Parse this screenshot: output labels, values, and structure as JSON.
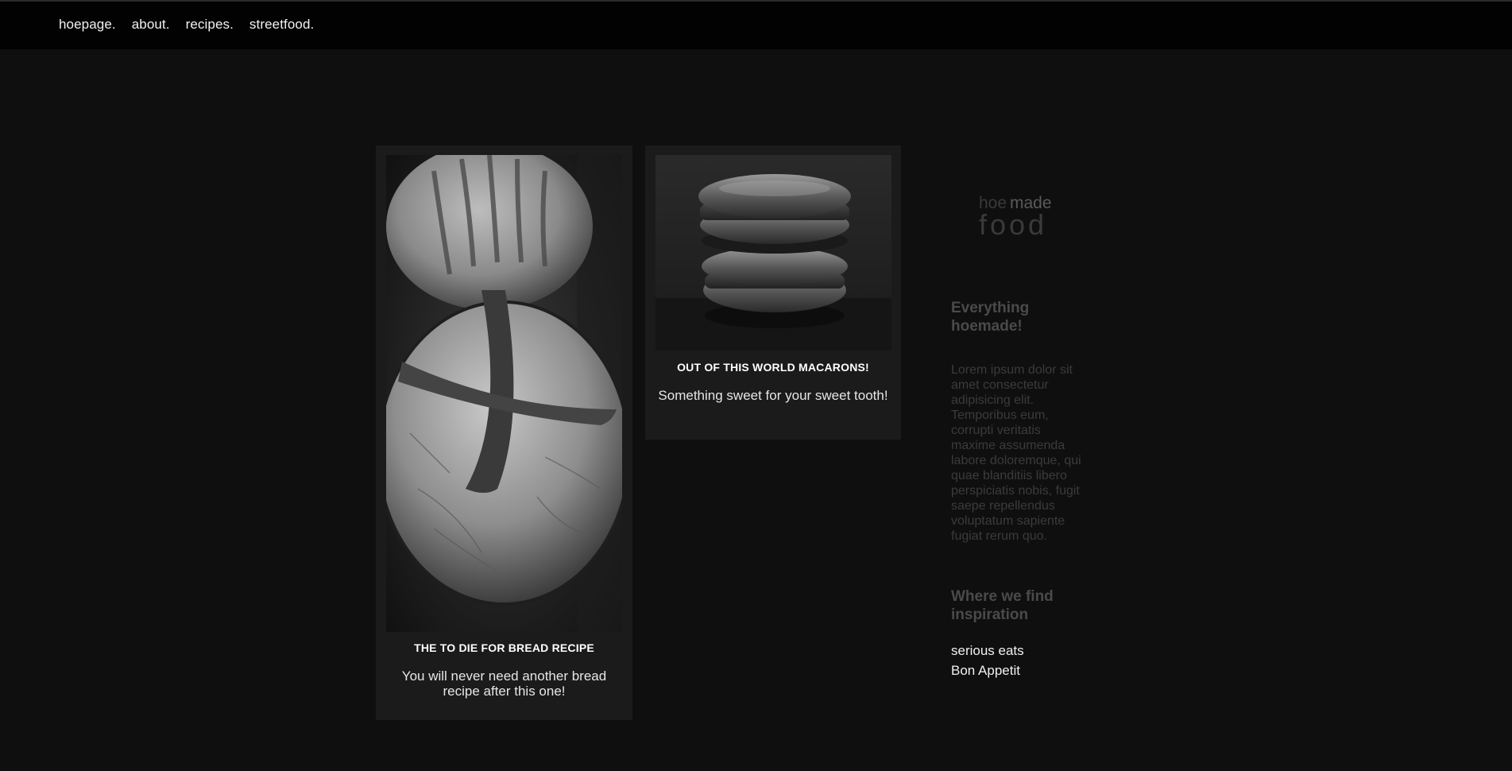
{
  "nav": {
    "items": [
      {
        "label": "hoepage."
      },
      {
        "label": "about."
      },
      {
        "label": "recipes."
      },
      {
        "label": "streetfood."
      }
    ]
  },
  "cards": [
    {
      "title": "THE TO DIE FOR BREAD RECIPE",
      "description": "You will never need another bread recipe after this one!"
    },
    {
      "title": "OUT OF THIS WORLD MACARONS!",
      "description": "Something sweet for your sweet tooth!"
    }
  ],
  "sidebar": {
    "logo": {
      "line1a": "hoe",
      "line1b": "made",
      "line2": "food"
    },
    "heading1": "Everything hoemade!",
    "paragraph": "Lorem ipsum dolor sit amet consectetur adipisicing elit. Temporibus eum, corrupti veritatis maxime assumenda labore doloremque, qui quae blanditiis libero perspiciatis nobis, fugit saepe repellendus voluptatum sapiente fugiat rerum quo.",
    "heading2": "Where we find inspiration",
    "links": [
      {
        "label": "serious eats"
      },
      {
        "label": "Bon Appetit"
      }
    ]
  },
  "colors": {
    "background": "#0f0f0f",
    "topbar": "#020202",
    "card": "#1b1b1b",
    "sidebar_text": "#4a4a4a"
  }
}
